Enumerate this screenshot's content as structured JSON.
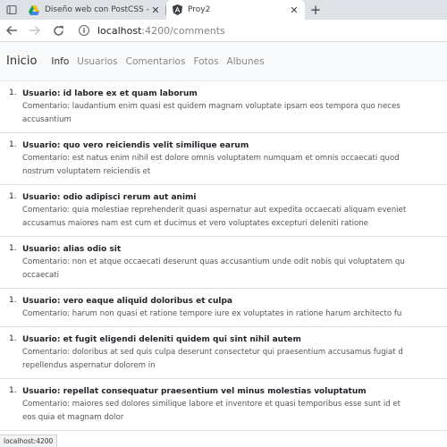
{
  "browser": {
    "tabs": [
      {
        "title": "Diseño web con PostCSS - Goog",
        "icon": "google-drive-icon",
        "active": false
      },
      {
        "title": "Proy2",
        "icon": "angular-icon",
        "active": true
      }
    ],
    "close_glyph": "✕",
    "new_tab_glyph": "+",
    "address": {
      "host": "localhost",
      "path": ":4200/comments"
    },
    "status_text": "localhost:4200"
  },
  "nav": {
    "brand": "Inicio",
    "links": [
      {
        "label": "Info",
        "active": true
      },
      {
        "label": "Usuarios",
        "active": false
      },
      {
        "label": "Comentarios",
        "active": false
      },
      {
        "label": "Fotos",
        "active": false
      },
      {
        "label": "Albunes",
        "active": false
      }
    ]
  },
  "comments": [
    {
      "num": "1.",
      "user": "Usuario: id labore ex et quam laborum",
      "lines": [
        "Comentario: laudantium enim quasi est quidem magnam voluptate ipsam eos tempora quo neces",
        "accusantium"
      ]
    },
    {
      "num": "1.",
      "user": "Usuario: quo vero reiciendis velit similique earum",
      "lines": [
        "Comentario: est natus enim nihil est dolore omnis voluptatem numquam et omnis occaecati quod",
        "nostrum voluptatem reiciendis et"
      ]
    },
    {
      "num": "1.",
      "user": "Usuario: odio adipisci rerum aut animi",
      "lines": [
        "Comentario: quia molestiae reprehenderit quasi aspernatur aut expedita occaecati aliquam eveniet",
        "accusamus maiores nam est cum et ducimus et vero voluptates excepturi deleniti ratione"
      ]
    },
    {
      "num": "1.",
      "user": "Usuario: alias odio sit",
      "lines": [
        "Comentario: non et atque occaecati deserunt quas accusantium unde odit nobis qui voluptatem qu",
        "occaecati"
      ]
    },
    {
      "num": "1.",
      "user": "Usuario: vero eaque aliquid doloribus et culpa",
      "lines": [
        "Comentario: harum non quasi et ratione tempore iure ex voluptates in ratione harum architecto fu"
      ]
    },
    {
      "num": "1.",
      "user": "Usuario: et fugit eligendi deleniti quidem qui sint nihil autem",
      "lines": [
        "Comentario: doloribus at sed quis culpa deserunt consectetur qui praesentium accusamus fugiat d",
        "repellendus aspernatur dolorem in"
      ]
    },
    {
      "num": "1.",
      "user": "Usuario: repellat consequatur praesentium vel minus molestias voluptatum",
      "lines": [
        "Comentario: maiores sed dolores similique labore et inventore et quasi temporibus esse sunt id et",
        "eos quia et magnam dolor"
      ]
    }
  ]
}
